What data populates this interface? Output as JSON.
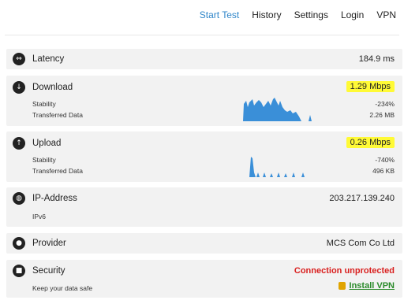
{
  "nav": {
    "items": [
      "Start Test",
      "History",
      "Settings",
      "Login",
      "VPN"
    ]
  },
  "latency": {
    "label": "Latency",
    "value": "184.9 ms"
  },
  "download": {
    "label": "Download",
    "value": "1.29 Mbps",
    "stability_label": "Stability",
    "stability_value": "-234%",
    "transferred_label": "Transferred Data",
    "transferred_value": "2.26 MB"
  },
  "upload": {
    "label": "Upload",
    "value": "0.26 Mbps",
    "stability_label": "Stability",
    "stability_value": "-740%",
    "transferred_label": "Transferred Data",
    "transferred_value": "496 KB"
  },
  "ip": {
    "label": "IP-Address",
    "value": "203.217.139.240",
    "sub_label": "IPv6"
  },
  "provider": {
    "label": "Provider",
    "value": "MCS Com Co Ltd"
  },
  "security": {
    "label": "Security",
    "status": "Connection unprotected",
    "sub_label": "Keep your data safe",
    "install_link": "Install VPN"
  },
  "colors": {
    "accent": "#2f86c9",
    "highlight": "#fffa36",
    "warning": "#d9201f",
    "link": "#2a8a2a"
  }
}
